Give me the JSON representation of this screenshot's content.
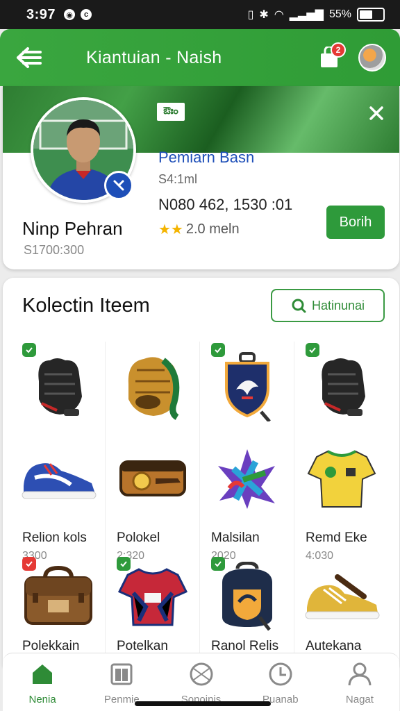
{
  "status": {
    "time": "3:97",
    "battery": "55%",
    "battery_level": 0.55
  },
  "appbar": {
    "title": "Kiantuian - Naish",
    "cart_count": "2"
  },
  "profile": {
    "banner_logo": "ఔఃం",
    "name": "Ninp Pehran",
    "sub": "S1700:300",
    "role": "Pemiarn Basn",
    "meta1": "S4:1ml",
    "meta2": "N080 462, 1530 :01",
    "stars": "★★",
    "rating_text": "2.0 meln",
    "button": "Borih"
  },
  "collection": {
    "title": "Kolectin Iteem",
    "filter_label": "Hatinunai",
    "items": [
      {
        "name": "",
        "price": "",
        "check": "green",
        "icon": "glove-black"
      },
      {
        "name": "",
        "price": "",
        "check": "",
        "icon": "glove-brown"
      },
      {
        "name": "",
        "price": "",
        "check": "green",
        "icon": "crest-badge"
      },
      {
        "name": "",
        "price": "",
        "check": "green",
        "icon": "glove-black"
      },
      {
        "name": "Relion kols",
        "price": "3300",
        "check": "",
        "icon": "sneaker-blue"
      },
      {
        "name": "Polokel",
        "price": "2:320",
        "check": "",
        "icon": "pencil-case"
      },
      {
        "name": "Malsilan",
        "price": "2020",
        "check": "",
        "icon": "leaf-emblem"
      },
      {
        "name": "Remd Eke",
        "price": "4:030",
        "check": "",
        "icon": "jersey-yellow"
      },
      {
        "name": "Polekkain",
        "price": "",
        "check": "red",
        "icon": "bag-brown"
      },
      {
        "name": "Potelkan",
        "price": "",
        "check": "green",
        "icon": "jersey-red"
      },
      {
        "name": "Ranol Relis",
        "price": "",
        "check": "green",
        "icon": "backpack-badge"
      },
      {
        "name": "Autekana",
        "price": "",
        "check": "",
        "icon": "sneaker-yellow"
      }
    ]
  },
  "nav": [
    {
      "label": "Nenia",
      "icon": "home-icon",
      "active": true
    },
    {
      "label": "Penmie",
      "icon": "store-icon",
      "active": false
    },
    {
      "label": "Sonoinis",
      "icon": "ball-icon",
      "active": false
    },
    {
      "label": "Puanab",
      "icon": "clock-icon",
      "active": false
    },
    {
      "label": "Nagat",
      "icon": "user-icon",
      "active": false
    }
  ],
  "colors": {
    "primary": "#2e9a3b",
    "accent_blue": "#1e4fb8",
    "badge_red": "#e53935",
    "star": "#f4b400"
  }
}
